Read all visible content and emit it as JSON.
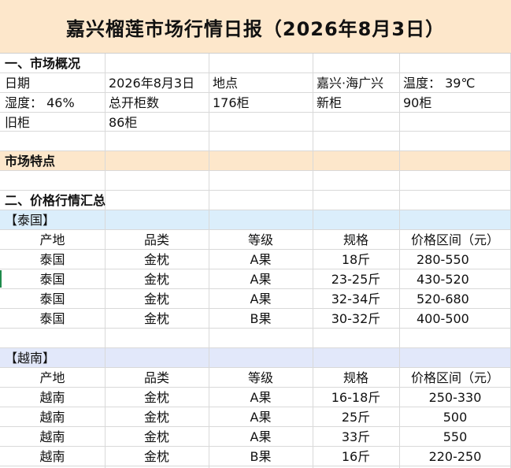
{
  "title": "嘉兴榴莲市场行情日报（2026年8月3日）",
  "overview": {
    "heading": "一、市场概况",
    "date_label": "日期",
    "date_value": "2026年8月3日",
    "place_label": "地点",
    "place_value": "嘉兴·海广兴",
    "temp": "温度： 39℃",
    "humidity": "湿度： 46%",
    "total_label": "总开柜数",
    "total_value": "176柜",
    "new_label": "新柜",
    "new_value": "90柜",
    "old_label": "旧柜",
    "old_value": "86柜"
  },
  "features_heading": "市场特点",
  "price_heading": "二、价格行情汇总",
  "headers": [
    "产地",
    "品类",
    "等级",
    "规格",
    "价格区间（元）"
  ],
  "thailand": {
    "label": "【泰国】",
    "rows": [
      [
        "泰国",
        "金枕",
        "A果",
        "18斤",
        "280-550"
      ],
      [
        "泰国",
        "金枕",
        "A果",
        "23-25斤",
        "430-520"
      ],
      [
        "泰国",
        "金枕",
        "A果",
        "32-34斤",
        "520-680"
      ],
      [
        "泰国",
        "金枕",
        "B果",
        "30-32斤",
        "400-500"
      ]
    ]
  },
  "vietnam": {
    "label": "【越南】",
    "rows": [
      [
        "越南",
        "金枕",
        "A果",
        "16-18斤",
        "250-330"
      ],
      [
        "越南",
        "金枕",
        "A果",
        "25斤",
        "500"
      ],
      [
        "越南",
        "金枕",
        "A果",
        "33斤",
        "550"
      ],
      [
        "越南",
        "金枕",
        "B果",
        "16斤",
        "220-250"
      ]
    ]
  }
}
